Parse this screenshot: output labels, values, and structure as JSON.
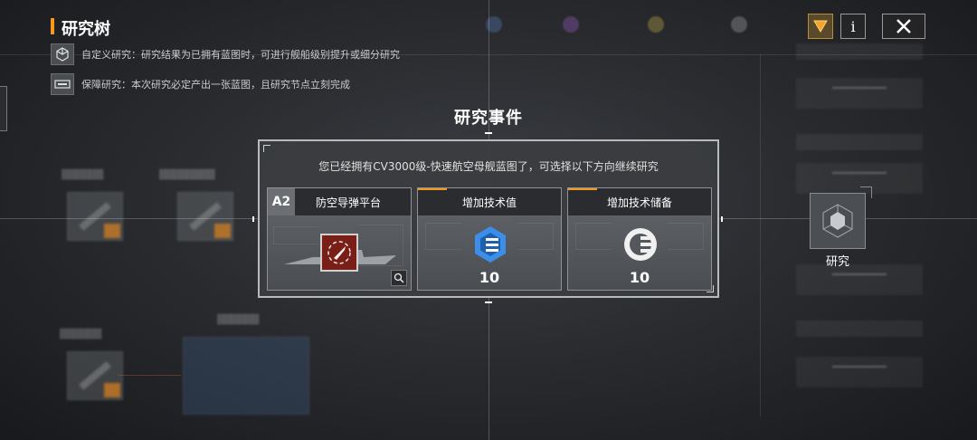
{
  "header": {
    "title": "研究树",
    "info": [
      {
        "icon": "cube-icon",
        "text": "自定义研究：研究结果为已拥有蓝图时，可进行舰船级别提升或细分研究"
      },
      {
        "icon": "blueprint-card-icon",
        "text": "保障研究：本次研究必定产出一张蓝图，且研究节点立刻完成"
      }
    ]
  },
  "top_buttons": {
    "filter_icon": "filter-triangle-icon",
    "info_label": "i",
    "close_icon": "close-icon"
  },
  "research_node": {
    "label": "研究",
    "icon": "research-hex-icon"
  },
  "dialog": {
    "title": "研究事件",
    "message": "您已经拥有CV3000级-快速航空母舰蓝图了，可选择以下方向继续研究",
    "options": [
      {
        "label": "防空导弹平台",
        "grade": "A2",
        "icon": "missile-icon"
      },
      {
        "label": "增加技术值",
        "value": "10",
        "icon": "tech-value-icon"
      },
      {
        "label": "增加技术储备",
        "value": "10",
        "icon": "tech-reserve-icon"
      }
    ]
  },
  "colors": {
    "accent": "#f39a1e",
    "missile_bg": "#7a1f17",
    "tech_value_blue": "#3d8ee8"
  }
}
